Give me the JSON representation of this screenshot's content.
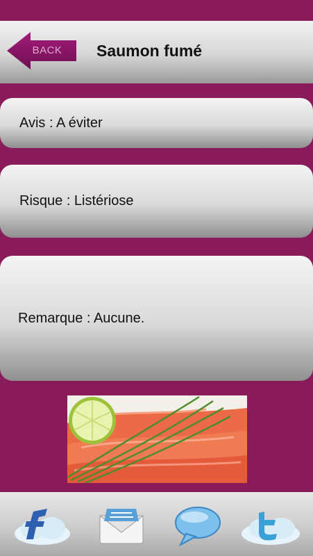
{
  "header": {
    "back_label": "BACK",
    "title": "Saumon fumé"
  },
  "cards": {
    "avis": "Avis : A éviter",
    "risque": "Risque : Listériose",
    "remarque": "Remarque : Aucune."
  },
  "image": {
    "subject": "smoked-salmon-with-lime-and-chives"
  },
  "tabbar": {
    "icons": [
      "facebook-cloud-icon",
      "mail-envelope-icon",
      "speech-bubble-icon",
      "twitter-cloud-icon"
    ]
  },
  "colors": {
    "background": "#8a1b5a",
    "back_button": "#8e1468",
    "back_label": "#e3a6d0"
  }
}
